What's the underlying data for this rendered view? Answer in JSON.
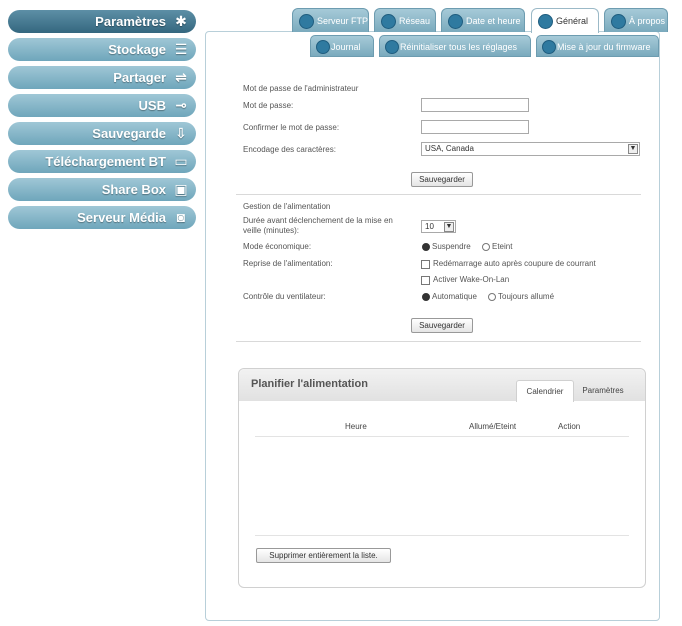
{
  "sidebar": {
    "items": [
      {
        "label": "Paramètres",
        "icon": "gear-icon"
      },
      {
        "label": "Stockage",
        "icon": "storage-icon"
      },
      {
        "label": "Partager",
        "icon": "share-icon"
      },
      {
        "label": "USB",
        "icon": "usb-icon"
      },
      {
        "label": "Sauvegarde",
        "icon": "backup-icon"
      },
      {
        "label": "Téléchargement BT",
        "icon": "bt-icon"
      },
      {
        "label": "Share Box",
        "icon": "sharebox-icon"
      },
      {
        "label": "Serveur Média",
        "icon": "media-icon"
      }
    ],
    "active_index": 0
  },
  "tabs": [
    "Serveur FTP",
    "Réseau",
    "Date et heure",
    "Général",
    "À propos"
  ],
  "active_tab": "Général",
  "subtabs": [
    "Journal",
    "Réinitialiser tous les réglages",
    "Mise à jour du firmware"
  ],
  "admin": {
    "section_title": "Mot de passe de l'administrateur",
    "password_label": "Mot de passe:",
    "confirm_label": "Confirmer le mot de passe:",
    "encoding_label": "Encodage des caractères:",
    "encoding_value": "USA, Canada",
    "save_label": "Sauvegarder"
  },
  "power": {
    "section_title": "Gestion de l'alimentation",
    "sleep_label_line1": "Durée avant déclenchement de la mise en",
    "sleep_label_line2": "veille (minutes):",
    "sleep_value": "10",
    "eco_label": "Mode économique:",
    "eco_options": [
      "Suspendre",
      "Eteint"
    ],
    "eco_selected": "Suspendre",
    "resume_label": "Reprise de l'alimentation:",
    "resume_opt1": "Redémarrage auto après coupure de courrant",
    "resume_opt2": "Activer Wake-On-Lan",
    "fan_label": "Contrôle du ventilateur:",
    "fan_options": [
      "Automatique",
      "Toujours allumé"
    ],
    "fan_selected": "Automatique",
    "save_label": "Sauvegarder"
  },
  "schedule": {
    "title": "Planifier l'alimentation",
    "tabs": [
      "Calendrier",
      "Paramètres"
    ],
    "active_tab": "Calendrier",
    "columns": [
      "Heure",
      "Allumé/Eteint",
      "Action"
    ],
    "delete_label": "Supprimer entièrement la liste."
  }
}
